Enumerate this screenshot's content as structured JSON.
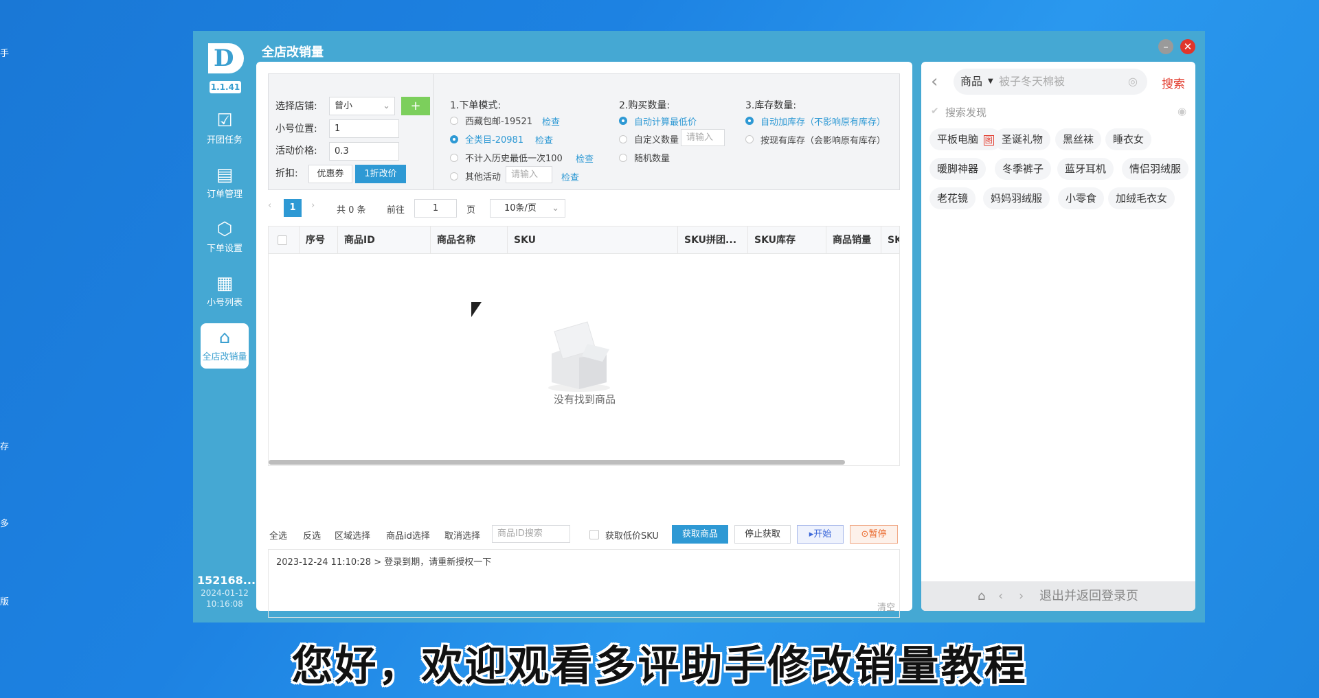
{
  "desktop": {
    "labels": [
      "手",
      "存",
      "多",
      "版"
    ]
  },
  "window": {
    "title": "全店改销量",
    "minimize": "–",
    "close": "✕"
  },
  "sidebar": {
    "logo": "D",
    "version": "1.1.41",
    "items": [
      {
        "label": "开团任务",
        "icon": "☑"
      },
      {
        "label": "订单管理",
        "icon": "▤"
      },
      {
        "label": "下单设置",
        "icon": "⬡"
      },
      {
        "label": "小号列表",
        "icon": "▦"
      },
      {
        "label": "全店改销量",
        "icon": "⌂"
      }
    ],
    "account": "152168...",
    "date": "2024-01-12",
    "time": "10:16:08"
  },
  "config": {
    "shop_label": "选择店铺:",
    "shop_value": "曾小",
    "add_button": "+",
    "position_label": "小号位置:",
    "position_value": "1",
    "price_label": "活动价格:",
    "price_value": "0.3",
    "discount_label": "折扣:",
    "coupon_button": "优惠券",
    "discount_button": "1折改价",
    "mode_title": "1.下单模式:",
    "mode_options": [
      {
        "label": "西藏包邮-19521",
        "check": "检查"
      },
      {
        "label": "全类目-20981",
        "check": "检查"
      },
      {
        "label": "不计入历史最低一次100",
        "check": "检查"
      },
      {
        "label": "其他活动",
        "placeholder": "请输入",
        "check": "检查"
      }
    ],
    "qty_title": "2.购买数量:",
    "qty_options": [
      "自动计算最低价",
      "自定义数量",
      "随机数量"
    ],
    "qty_placeholder": "请输入",
    "stock_title": "3.库存数量:",
    "stock_options": [
      "自动加库存（不影响原有库存）",
      "按现有库存（会影响原有库存）"
    ]
  },
  "pagination": {
    "current": "1",
    "total": "共 0 条",
    "goto_label": "前往",
    "goto_value": "1",
    "page_unit": "页",
    "page_size": "10条/页"
  },
  "table": {
    "headers": [
      "序号",
      "商品ID",
      "商品名称",
      "SKU",
      "SKU拼团...",
      "SKU库存",
      "商品销量",
      "SK"
    ],
    "empty_text": "没有找到商品"
  },
  "toolbar": {
    "select_all": "全选",
    "invert": "反选",
    "region_select": "区域选择",
    "id_select": "商品id选择",
    "cancel": "取消选择",
    "id_search_placeholder": "商品ID搜索",
    "low_sku_label": "获取低价SKU",
    "fetch": "获取商品",
    "stop": "停止获取",
    "start": "▸开始",
    "pause": "⊙暂停"
  },
  "log": {
    "line": "2023-12-24 11:10:28 > 登录到期，请重新授权一下",
    "clear": "清空"
  },
  "browser": {
    "back": "‹",
    "search_type": "商品",
    "search_placeholder": "被子冬天棉被",
    "search_button": "搜索",
    "discover_title": "搜索发现",
    "tags": [
      "平板电脑",
      "圣诞礼物",
      "黑丝袜",
      "睡衣女",
      "暖脚神器",
      "冬季裤子",
      "蓝牙耳机",
      "情侣羽绒服",
      "老花镜",
      "妈妈羽绒服",
      "小零食",
      "加绒毛衣女"
    ],
    "tag_badge": "图",
    "footer_home": "⌂",
    "footer_prev": "‹",
    "footer_next": "›",
    "footer_text": "退出并返回登录页"
  },
  "subtitle": "您好，欢迎观看多评助手修改销量教程"
}
